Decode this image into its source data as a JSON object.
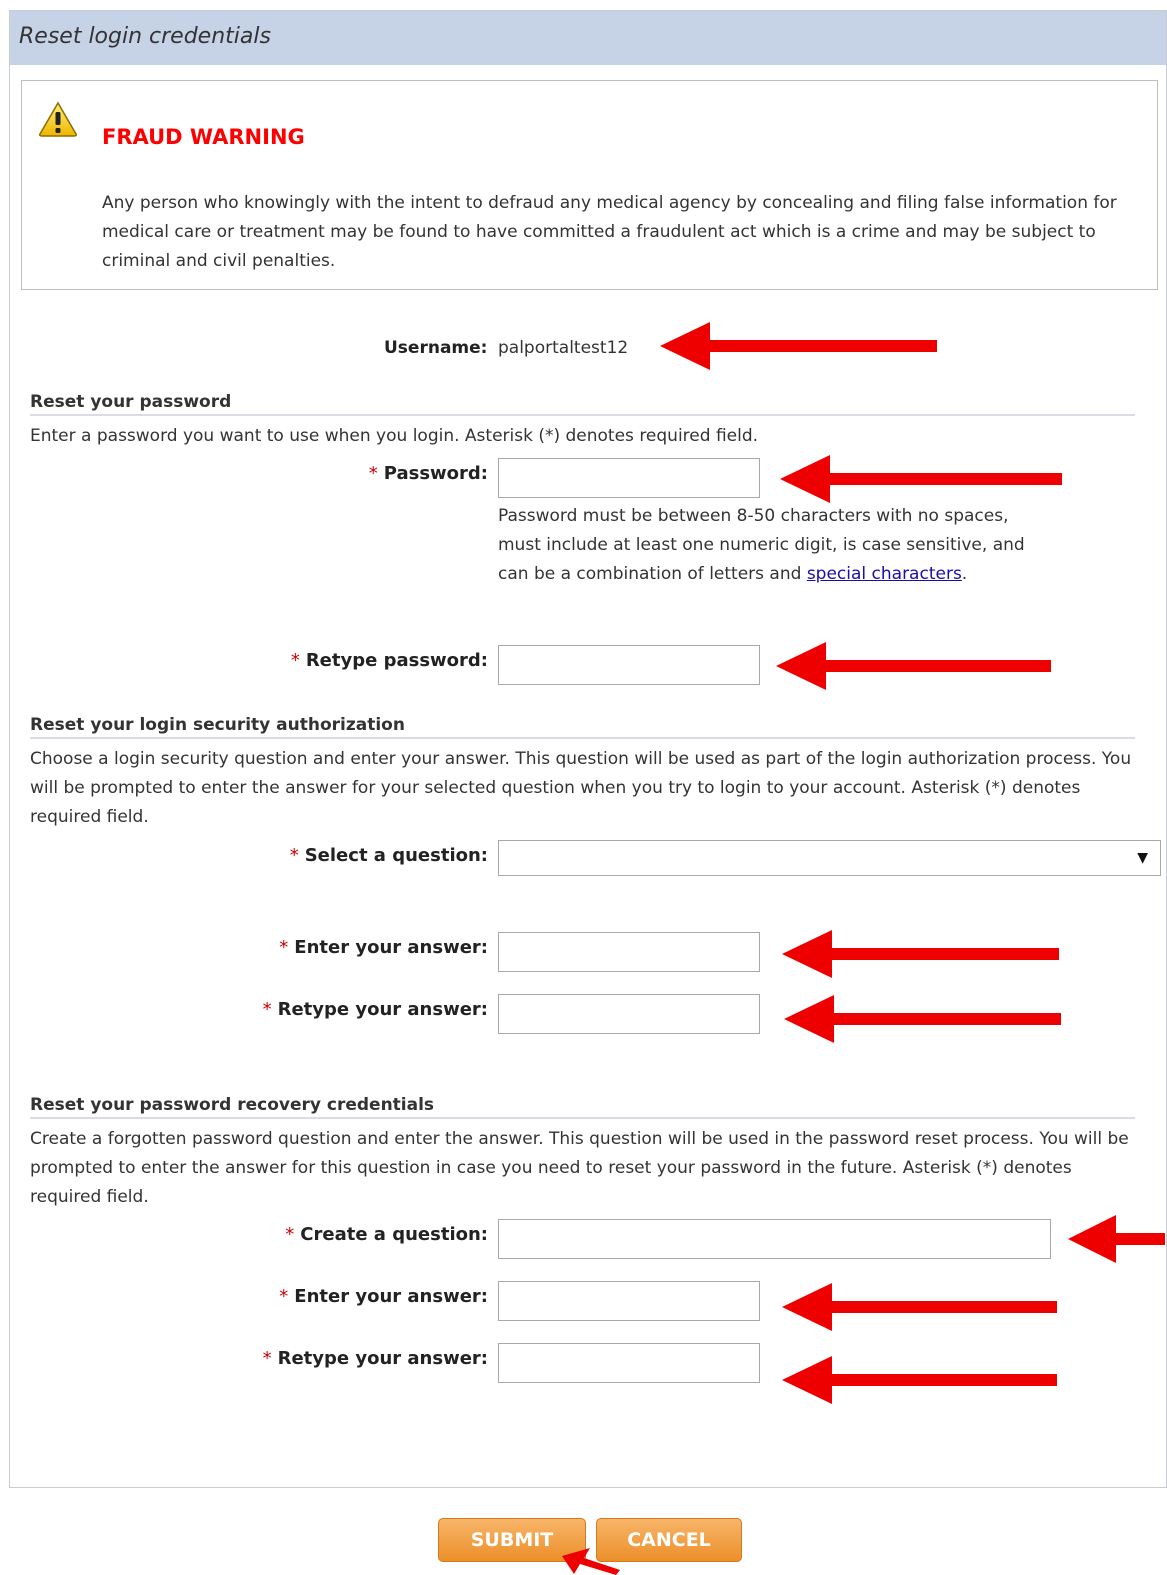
{
  "header": {
    "title": "Reset login credentials"
  },
  "warning": {
    "title": "FRAUD WARNING",
    "text": "Any person who knowingly with the intent to defraud any medical agency by concealing and filing false information for medical care or treatment may be found to have committed a fraudulent act which is a crime and may be subject to criminal and civil penalties."
  },
  "username": {
    "label": "Username:",
    "value": "palportaltest12"
  },
  "password_section": {
    "title": "Reset your password",
    "description": "Enter a password you want to use when you login. Asterisk (*) denotes required field.",
    "password_label": "Password:",
    "hint_text": "Password must be between 8-50 characters with no spaces, must include at least one numeric digit, is case sensitive, and can be a combination of letters and ",
    "hint_link": "special characters",
    "hint_end": ".",
    "retype_label": "Retype password:"
  },
  "security_section": {
    "title": "Reset your login security authorization",
    "description": "Choose a login security question and enter your answer. This question will be used as part of the login authorization process. You will be prompted to enter the answer for your selected question when you try to login to your account. Asterisk (*) denotes required field.",
    "question_label": "Select a question:",
    "question_value": "",
    "answer_label": "Enter your answer:",
    "retype_answer_label": "Retype your answer:"
  },
  "recovery_section": {
    "title": "Reset your password recovery credentials",
    "description": "Create a forgotten password question and enter the answer. This question will be used in the password reset process. You will be prompted to enter the answer for this question in case you need to reset your password in the future. Asterisk (*) denotes required field.",
    "question_label": "Create a question:",
    "answer_label": "Enter your answer:",
    "retype_answer_label": "Retype your answer:"
  },
  "required_marker": "*",
  "buttons": {
    "submit": "SUBMIT",
    "cancel": "CANCEL"
  },
  "colors": {
    "header_bg": "#c6d2e6",
    "warning_title": "#ff0000",
    "button": "#ec8f2a",
    "arrow": "#ee0000"
  },
  "icons": {
    "warning": "warning-triangle-icon",
    "dropdown": "dropdown-caret-icon"
  }
}
